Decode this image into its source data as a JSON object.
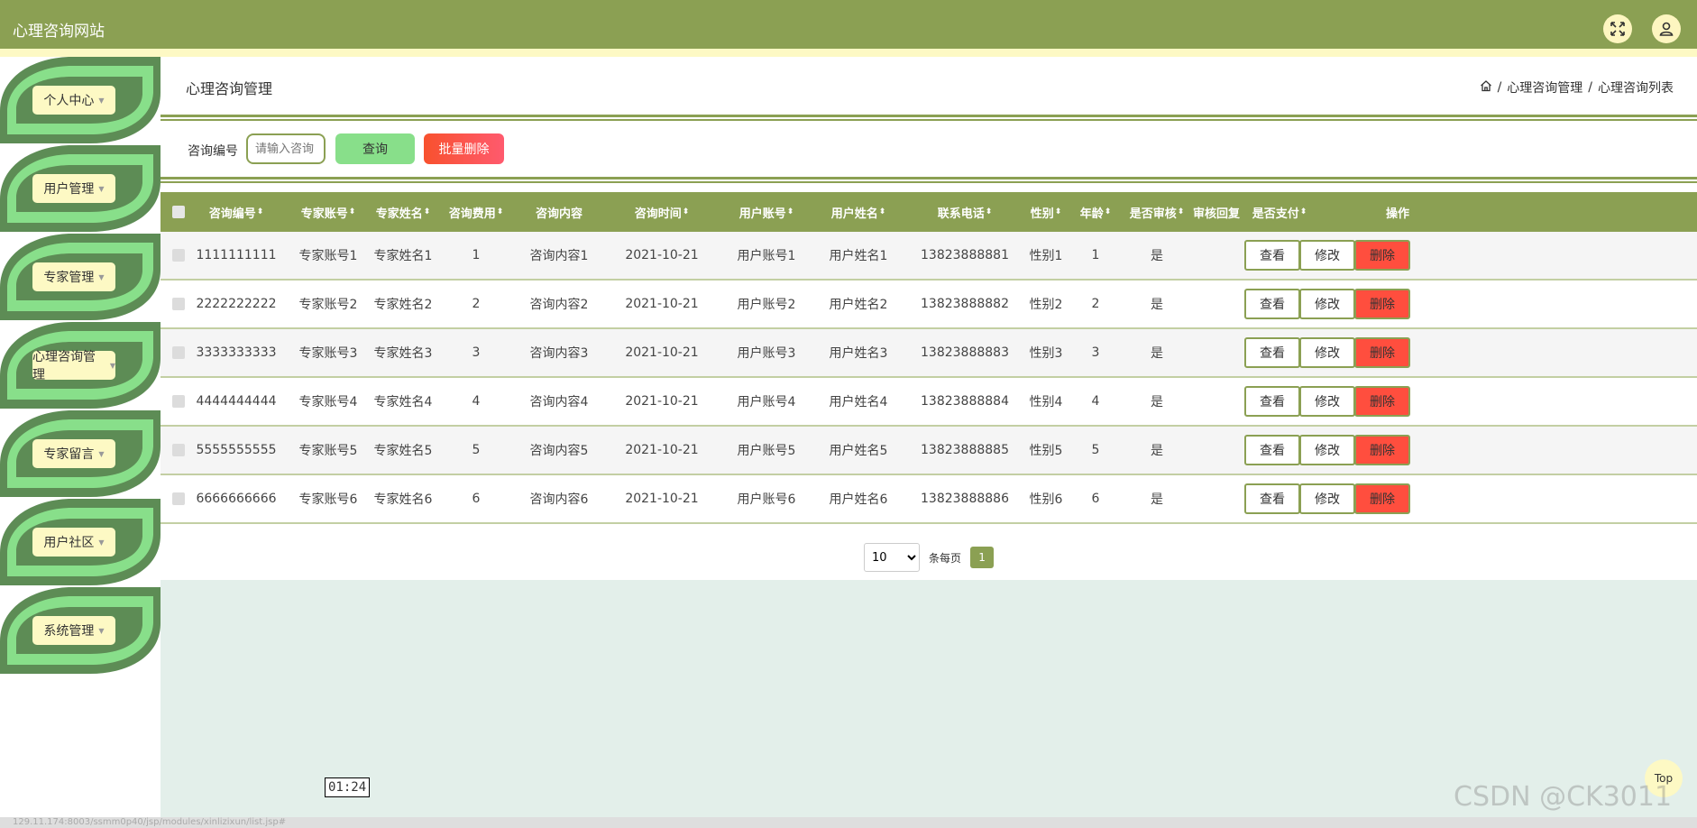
{
  "header": {
    "site_title": "心理咨询网站"
  },
  "sidebar": {
    "items": [
      {
        "label": "个人中心"
      },
      {
        "label": "用户管理"
      },
      {
        "label": "专家管理"
      },
      {
        "label": "心理咨询管理"
      },
      {
        "label": "专家留言"
      },
      {
        "label": "用户社区"
      },
      {
        "label": "系统管理"
      }
    ]
  },
  "page": {
    "title": "心理咨询管理",
    "breadcrumb": [
      "心理咨询管理",
      "心理咨询列表"
    ],
    "breadcrumb_sep": "/"
  },
  "search": {
    "label": "咨询编号",
    "placeholder": "请输入咨询",
    "query_label": "查询",
    "batch_delete_label": "批量删除"
  },
  "table": {
    "headers": [
      {
        "label": "咨询编号",
        "sortable": true
      },
      {
        "label": "专家账号",
        "sortable": true
      },
      {
        "label": "专家姓名",
        "sortable": true
      },
      {
        "label": "咨询费用",
        "sortable": true
      },
      {
        "label": "咨询内容",
        "sortable": false
      },
      {
        "label": "咨询时间",
        "sortable": true
      },
      {
        "label": "用户账号",
        "sortable": true
      },
      {
        "label": "用户姓名",
        "sortable": true
      },
      {
        "label": "联系电话",
        "sortable": true
      },
      {
        "label": "性别",
        "sortable": true
      },
      {
        "label": "年龄",
        "sortable": true
      },
      {
        "label": "是否审核",
        "sortable": true
      },
      {
        "label": "审核回复",
        "sortable": false
      },
      {
        "label": "是否支付",
        "sortable": true
      },
      {
        "label": "操作",
        "sortable": false
      }
    ],
    "sort_glyph": "⬍",
    "actions": {
      "view": "查看",
      "edit": "修改",
      "delete": "删除"
    },
    "rows": [
      [
        "1111111111",
        "专家账号1",
        "专家姓名1",
        "1",
        "咨询内容1",
        "2021-10-21",
        "用户账号1",
        "用户姓名1",
        "13823888881",
        "性别1",
        "1",
        "是",
        "",
        ""
      ],
      [
        "2222222222",
        "专家账号2",
        "专家姓名2",
        "2",
        "咨询内容2",
        "2021-10-21",
        "用户账号2",
        "用户姓名2",
        "13823888882",
        "性别2",
        "2",
        "是",
        "",
        ""
      ],
      [
        "3333333333",
        "专家账号3",
        "专家姓名3",
        "3",
        "咨询内容3",
        "2021-10-21",
        "用户账号3",
        "用户姓名3",
        "13823888883",
        "性别3",
        "3",
        "是",
        "",
        ""
      ],
      [
        "4444444444",
        "专家账号4",
        "专家姓名4",
        "4",
        "咨询内容4",
        "2021-10-21",
        "用户账号4",
        "用户姓名4",
        "13823888884",
        "性别4",
        "4",
        "是",
        "",
        ""
      ],
      [
        "5555555555",
        "专家账号5",
        "专家姓名5",
        "5",
        "咨询内容5",
        "2021-10-21",
        "用户账号5",
        "用户姓名5",
        "13823888885",
        "性别5",
        "5",
        "是",
        "",
        ""
      ],
      [
        "6666666666",
        "专家账号6",
        "专家姓名6",
        "6",
        "咨询内容6",
        "2021-10-21",
        "用户账号6",
        "用户姓名6",
        "13823888886",
        "性别6",
        "6",
        "是",
        "",
        ""
      ]
    ]
  },
  "pagination": {
    "page_size": "10",
    "per_page_label": "条每页",
    "current_page": "1"
  },
  "misc": {
    "timer": "01:24",
    "top_label": "Top",
    "watermark": "CSDN @CK3011",
    "status_url": "129.11.174:8003/ssmm0p40/jsp/modules/xinlizixun/list.jsp#"
  },
  "colors": {
    "accent": "#8ba053",
    "light_yellow": "#fdf9c4",
    "leaf_dark": "#5d8c55",
    "leaf_light": "#88df8a",
    "delete_red": "#ff4e3e",
    "main_bg": "#e3efea"
  },
  "icons": {
    "fullscreen": "fullscreen-icon",
    "user": "user-icon",
    "home": "home-icon"
  }
}
